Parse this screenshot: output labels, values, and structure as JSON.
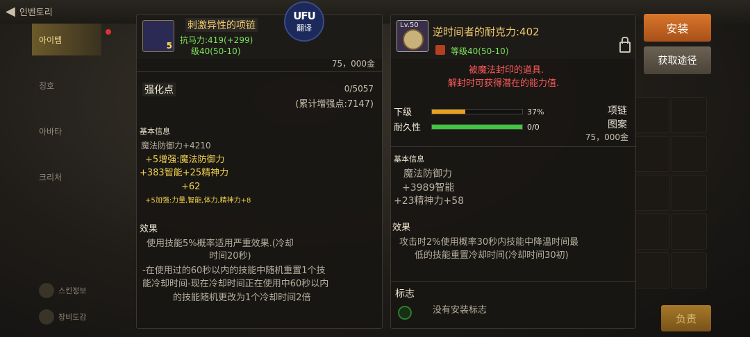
{
  "topbar": {
    "back_label": "인벤토리"
  },
  "sidenav": {
    "items": [
      "아이템",
      "칭호",
      "아바타",
      "크리처"
    ],
    "bottom_items": [
      "스킨정보",
      "장비도감"
    ]
  },
  "translate": {
    "logo": "UFU",
    "label": "翻译"
  },
  "panel_left": {
    "name": "刺激异性的项链",
    "icon_badge": "5",
    "stat_line": "抗马力:419(+299)",
    "level_line": "级40(50-10)",
    "price": "75，000金",
    "enhance_label": "强化点",
    "enhance_value": "0/5057",
    "enhance_total": "(累计增强点:7147)",
    "basic_title": "基本信息",
    "basic_lines": [
      "魔法防御力+4210",
      "+5增强:魔法防御力",
      "+383智能+25精神力",
      "+62",
      "+5加强:力量,智能,体力,精神力+8"
    ],
    "effect_title": "效果",
    "effect_lines": [
      "使用技能5%概率适用严重效果.(冷却",
      "时间20秒)",
      "-在使用过的60秒以内的技能中随机重置1个技",
      "能冷却时间-现在冷却时间正在使用中60秒以内",
      "的技能随机更改为1个冷却时间2倍"
    ]
  },
  "panel_right": {
    "icon_level": "Lv.50",
    "name": "逆时间者的耐克力:402",
    "level_line": "等级40(50-10)",
    "sealed_lines": [
      "被魔法封印的道具.",
      "解封时可获得潜在的能力值."
    ],
    "grade_label": "下级",
    "grade_value": "37%",
    "durability_label": "耐久性",
    "durability_value": "0/0",
    "type_lines": [
      "项链",
      "图案"
    ],
    "price": "75，000金",
    "basic_title": "基本信息",
    "basic_lines": [
      "魔法防御力",
      "+3989智能",
      "+23精神力+58"
    ],
    "effect_title": "效果",
    "effect_lines": [
      "攻击时2%使用概率30秒内技能中降温时间最",
      "低的技能重置冷却时间(冷却时间30初)"
    ],
    "emblem_title": "标志",
    "emblem_value": "没有安装标志"
  },
  "buttons": {
    "install": "安装",
    "source": "获取途径",
    "equip": "负责"
  },
  "progress": {
    "grade_fraction": 0.37,
    "durability_fraction": 1.0
  },
  "colors": {
    "accent_orange": "#d9762a",
    "title_gold": "#f0c870",
    "stat_green": "#7be05a",
    "buff_yellow": "#f0d050",
    "warning_red": "#ff5b5b"
  }
}
